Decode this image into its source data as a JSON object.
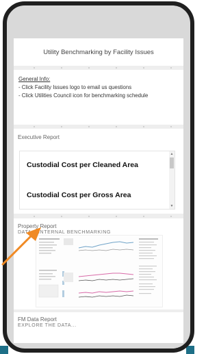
{
  "header": {
    "title": "Utility Benchmarking by Facility Issues"
  },
  "general_info": {
    "heading": "General Info:",
    "lines": [
      " - Click Facility Issues logo to email us questions",
      " - Click Utilities Council icon for benchmarking schedule"
    ]
  },
  "executive_report": {
    "label": "Executive Report",
    "items": [
      "Custodial Cost per Cleaned Area",
      "Custodial Cost per Gross Area"
    ]
  },
  "property_report": {
    "label": "Property Report",
    "subtitle": "DATA & INTERNAL BENCHMARKING"
  },
  "fm_report": {
    "label": "FM Data Report",
    "subtitle": "EXPLORE THE DATA..."
  },
  "colors": {
    "phone_frame": "#1f1f1f",
    "accent_teal": "#1e6f87",
    "arrow_orange": "#f08a24"
  }
}
